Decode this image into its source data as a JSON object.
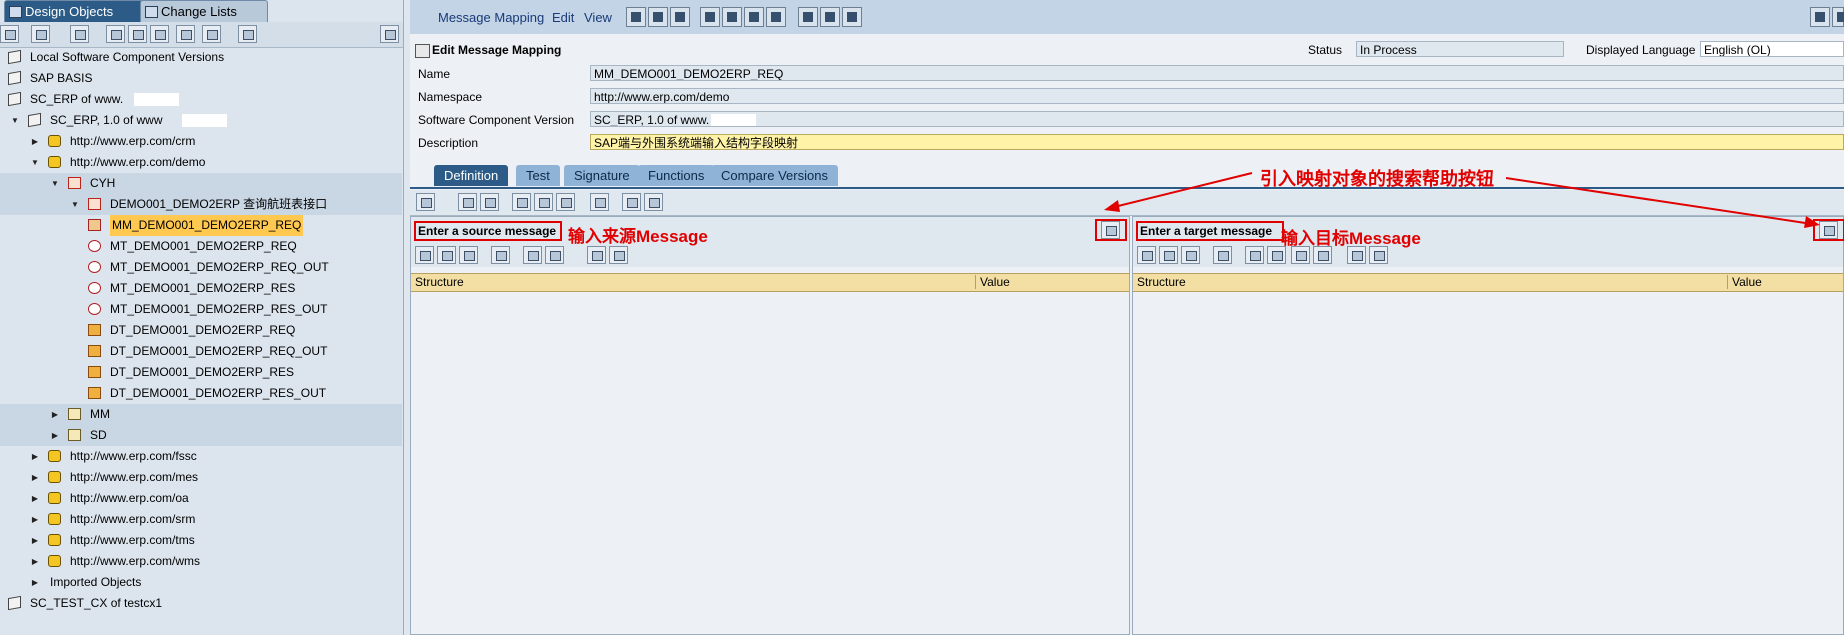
{
  "left_panel": {
    "tabs": [
      {
        "label": "Design Objects",
        "active": true
      },
      {
        "label": "Change Lists",
        "active": false
      }
    ],
    "tree": [
      {
        "label": "Local Software Component Versions",
        "icon": "cube-icon",
        "level": 0,
        "expand": ""
      },
      {
        "label": "SAP BASIS",
        "icon": "cube-icon",
        "level": 0,
        "expand": ""
      },
      {
        "label": "SC_ERP of www.",
        "icon": "cube-icon",
        "level": 0,
        "expand": "",
        "masked": true
      },
      {
        "label": "SC_ERP, 1.0 of www",
        "icon": "cube-icon",
        "level": 0,
        "expand": "▼",
        "masked": true
      },
      {
        "label": "http://www.erp.com/crm",
        "icon": "namespace-icon",
        "level": 1,
        "expand": "▶"
      },
      {
        "label": "http://www.erp.com/demo",
        "icon": "namespace-icon",
        "level": 1,
        "expand": "▼"
      },
      {
        "label": "CYH",
        "icon": "folder-icon",
        "level": 2,
        "expand": "▼",
        "hl": true
      },
      {
        "label": "DEMO001_DEMO2ERP 查询航班表接口",
        "icon": "folder-icon",
        "level": 3,
        "expand": "▼",
        "hl": true
      },
      {
        "label": "MM_DEMO001_DEMO2ERP_REQ",
        "icon": "message-mapping-icon",
        "level": 4,
        "expand": "",
        "selected": true
      },
      {
        "label": "MT_DEMO001_DEMO2ERP_REQ",
        "icon": "message-type-icon",
        "level": 4,
        "expand": ""
      },
      {
        "label": "MT_DEMO001_DEMO2ERP_REQ_OUT",
        "icon": "message-type-icon",
        "level": 4,
        "expand": ""
      },
      {
        "label": "MT_DEMO001_DEMO2ERP_RES",
        "icon": "message-type-icon",
        "level": 4,
        "expand": ""
      },
      {
        "label": "MT_DEMO001_DEMO2ERP_RES_OUT",
        "icon": "message-type-icon",
        "level": 4,
        "expand": ""
      },
      {
        "label": "DT_DEMO001_DEMO2ERP_REQ",
        "icon": "data-type-icon",
        "level": 4,
        "expand": ""
      },
      {
        "label": "DT_DEMO001_DEMO2ERP_REQ_OUT",
        "icon": "data-type-icon",
        "level": 4,
        "expand": ""
      },
      {
        "label": "DT_DEMO001_DEMO2ERP_RES",
        "icon": "data-type-icon",
        "level": 4,
        "expand": ""
      },
      {
        "label": "DT_DEMO001_DEMO2ERP_RES_OUT",
        "icon": "data-type-icon",
        "level": 4,
        "expand": ""
      },
      {
        "label": "MM",
        "icon": "folder-icon",
        "level": 2,
        "expand": "▶",
        "hl": true
      },
      {
        "label": "SD",
        "icon": "folder-icon",
        "level": 2,
        "expand": "▶",
        "hl": true
      },
      {
        "label": "http://www.erp.com/fssc",
        "icon": "namespace-icon",
        "level": 1,
        "expand": "▶"
      },
      {
        "label": "http://www.erp.com/mes",
        "icon": "namespace-icon",
        "level": 1,
        "expand": "▶"
      },
      {
        "label": "http://www.erp.com/oa",
        "icon": "namespace-icon",
        "level": 1,
        "expand": "▶"
      },
      {
        "label": "http://www.erp.com/srm",
        "icon": "namespace-icon",
        "level": 1,
        "expand": "▶"
      },
      {
        "label": "http://www.erp.com/tms",
        "icon": "namespace-icon",
        "level": 1,
        "expand": "▶"
      },
      {
        "label": "http://www.erp.com/wms",
        "icon": "namespace-icon",
        "level": 1,
        "expand": "▶"
      },
      {
        "label": "Imported Objects",
        "icon": "",
        "level": 1,
        "expand": "▶"
      },
      {
        "label": "SC_TEST_CX of testcx1",
        "icon": "cube-icon",
        "level": 0,
        "expand": ""
      }
    ]
  },
  "menu": {
    "items": [
      "Message Mapping",
      "Edit",
      "View"
    ]
  },
  "header": {
    "title": "Edit Message Mapping",
    "status_label": "Status",
    "status_value": "In Process",
    "language_label": "Displayed Language",
    "language_value": "English (OL)"
  },
  "fields": {
    "name_label": "Name",
    "name_value": "MM_DEMO001_DEMO2ERP_REQ",
    "namespace_label": "Namespace",
    "namespace_value": "http://www.erp.com/demo",
    "scv_label": "Software Component Version",
    "scv_value": "SC_ERP, 1.0 of www.",
    "description_label": "Description",
    "description_value": "SAP端与外围系统端输入结构字段映射"
  },
  "detail_tabs": [
    "Definition",
    "Test",
    "Signature",
    "Functions",
    "Compare Versions"
  ],
  "source_pane": {
    "placeholder": "Enter a source message",
    "col_structure": "Structure",
    "col_value": "Value"
  },
  "target_pane": {
    "placeholder": "Enter a target message",
    "col_structure": "Structure",
    "col_value": "Value"
  },
  "annotations": {
    "search_help": "引入映射对象的搜索帮助按钮",
    "source": "输入来源Message",
    "target": "输入目标Message"
  },
  "colors": {
    "accent": "#2b5b86",
    "annotation": "#e00000",
    "selection": "#ffc850"
  }
}
